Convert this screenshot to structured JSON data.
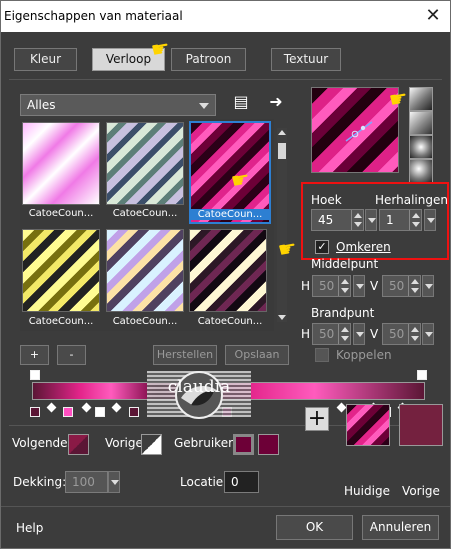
{
  "window": {
    "title": "Eigenschappen van materiaal",
    "close": "✕"
  },
  "tabs": [
    {
      "label": "Kleur",
      "active": false
    },
    {
      "label": "Verloop",
      "active": true
    },
    {
      "label": "Patroon",
      "active": false
    },
    {
      "label": "Textuur",
      "active": false
    }
  ],
  "library": {
    "category": "Alles",
    "buttons": {
      "browse_icon": "document-list-icon",
      "arrow_icon": "right-arrow-icon"
    },
    "items": [
      {
        "label": "CatoeCoun...",
        "selected": false,
        "gradient": "pink-white"
      },
      {
        "label": "CatoeCoun...",
        "selected": false,
        "gradient": "blue-green-white"
      },
      {
        "label": "CatoeCoun...",
        "selected": true,
        "gradient": "magenta-black"
      },
      {
        "label": "CatoeCoun...",
        "selected": false,
        "gradient": "yellow-black"
      },
      {
        "label": "CatoeCoun...",
        "selected": false,
        "gradient": "rainbow-pastel"
      },
      {
        "label": "CatoeCoun...",
        "selected": false,
        "gradient": "purple-cream"
      }
    ],
    "add_button": "+",
    "remove_button": "-",
    "reset_button": "Herstellen",
    "save_button": "Opslaan"
  },
  "style_buttons": [
    {
      "name": "linear-style-icon"
    },
    {
      "name": "rectangular-style-icon"
    },
    {
      "name": "sunburst-style-icon"
    },
    {
      "name": "radial-style-icon"
    }
  ],
  "settings": {
    "angle_label": "Hoek",
    "angle_value": "45",
    "repeats_label": "Herhalingen",
    "repeats_value": "1",
    "invert_label": "Omkeren",
    "invert_checked": true,
    "center_label": "Middelpunt",
    "center_h": "50",
    "center_v": "50",
    "focal_label": "Brandpunt",
    "focal_h": "50",
    "focal_v": "50",
    "link_label": "Koppelen",
    "h_label": "H",
    "v_label": "V"
  },
  "watermark": {
    "text": "claudia"
  },
  "bottom": {
    "next_label": "Volgende:",
    "previous_label": "Vorige:",
    "user_label": "Gebruiker:",
    "opacity_label": "Dekking:",
    "opacity_value": "100",
    "location_label": "Locatie:",
    "location_value": "0",
    "current_label": "Huidige",
    "previous_swatch_label": "Vorige"
  },
  "footer": {
    "help": "Help",
    "ok": "OK",
    "cancel": "Annuleren"
  },
  "colors": {
    "dark_bg": "#3c3c3c",
    "magenta": "#d61a82",
    "pink": "#ff4fc1",
    "dark_burgundy": "#5b1635",
    "burgundy": "#74213f",
    "selection_blue": "#2d7fd2",
    "red_highlight": "#ee1111",
    "hand_yellow": "#ffd400"
  }
}
